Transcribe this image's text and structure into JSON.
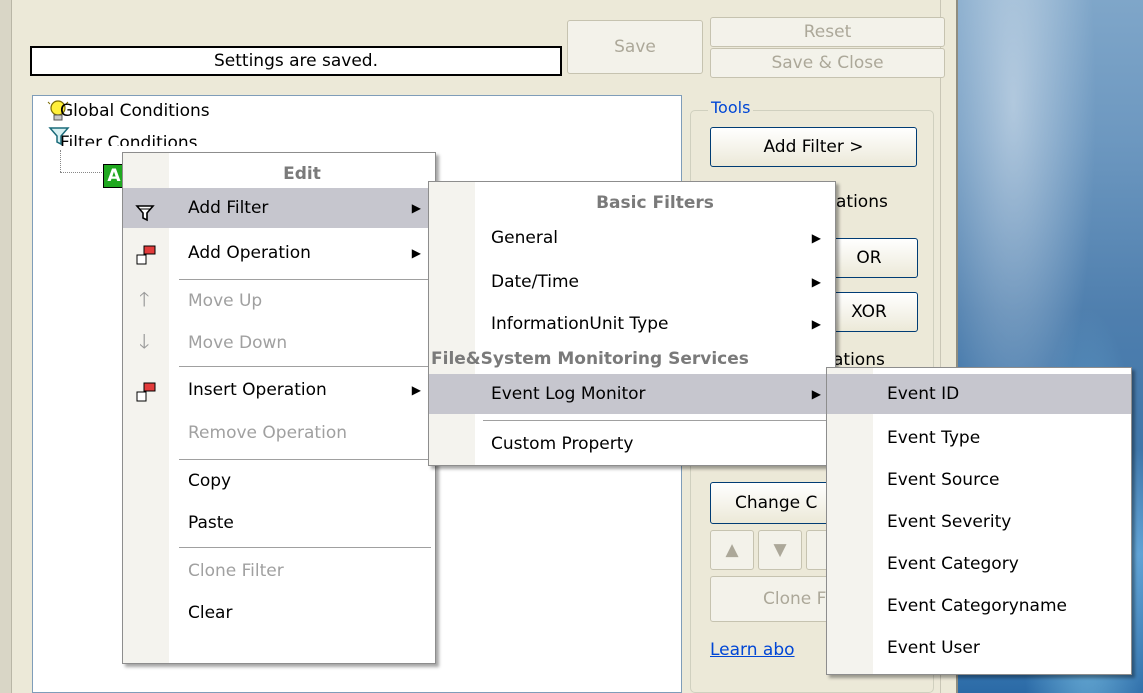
{
  "status_text": "Settings are saved.",
  "buttons": {
    "save": "Save",
    "reset": "Reset",
    "save_close": "Save & Close"
  },
  "tree": {
    "global_conditions": "Global Conditions",
    "filter_conditions": "Filter Conditions",
    "node_letter": "A"
  },
  "tools": {
    "title": "Tools",
    "add_filter": "Add Filter >",
    "ops_partial": "ations",
    "or": "OR",
    "xor": "XOR",
    "ops_partial2": "rations",
    "change": "Change C",
    "clone": "Clone F",
    "learn": "Learn abo"
  },
  "context_menu": {
    "header": "Edit",
    "items": [
      {
        "label": "Add Filter",
        "icon": "filter-icon",
        "enabled": true,
        "submenu": true,
        "highlighted": true
      },
      {
        "label": "Add Operation",
        "icon": "operation-icon",
        "enabled": true,
        "submenu": true
      },
      {
        "label": "Move Up",
        "icon": "arrow-up-icon",
        "enabled": false
      },
      {
        "label": "Move Down",
        "icon": "arrow-down-icon",
        "enabled": false
      },
      {
        "label": "Insert Operation",
        "icon": "operation-icon",
        "enabled": true,
        "submenu": true
      },
      {
        "label": "Remove Operation",
        "enabled": false
      },
      {
        "label": "Copy",
        "enabled": true
      },
      {
        "label": "Paste",
        "enabled": true
      },
      {
        "label": "Clone Filter",
        "enabled": false
      },
      {
        "label": "Clear",
        "enabled": true
      }
    ]
  },
  "filters_menu": {
    "header_basic": "Basic Filters",
    "items_basic": [
      "General",
      "Date/Time",
      "InformationUnit Type"
    ],
    "header_fs": "File&System Monitoring Services",
    "item_event_log": "Event Log Monitor",
    "item_custom": "Custom Property"
  },
  "eventlog_menu": {
    "items": [
      "Event ID",
      "Event Type",
      "Event Source",
      "Event Severity",
      "Event Category",
      "Event Categoryname",
      "Event User"
    ]
  },
  "colors": {
    "highlight": "#c6c6ce",
    "link": "#0046d5",
    "node_green": "#1fa81f"
  }
}
